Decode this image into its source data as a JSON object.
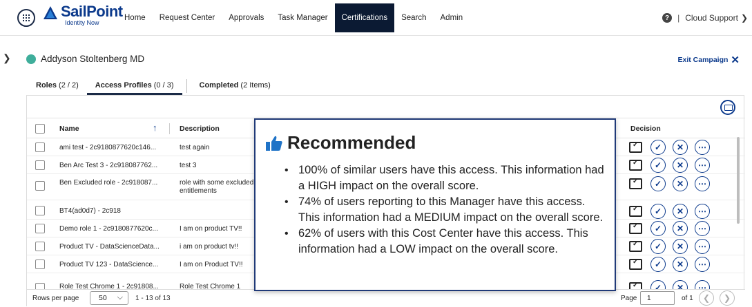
{
  "nav": {
    "brand": "SailPoint",
    "brand_sub": "Identity Now",
    "items": [
      "Home",
      "Request Center",
      "Approvals",
      "Task Manager",
      "Certifications",
      "Search",
      "Admin"
    ],
    "active": "Certifications",
    "user": "Cloud Support",
    "separator": "|"
  },
  "identity": {
    "name": "Addyson Stoltenberg MD",
    "exit_label": "Exit Campaign"
  },
  "tabs": [
    {
      "label": "Roles",
      "count": "(2 / 2)"
    },
    {
      "label": "Access Profiles",
      "count": "(0 / 3)"
    },
    {
      "label": "Completed",
      "count": "(2 Items)"
    }
  ],
  "table": {
    "headers": {
      "name": "Name",
      "description": "Description",
      "decision": "Decision"
    },
    "rows": [
      {
        "name": "ami test - 2c9180877620c146...",
        "description": "test again"
      },
      {
        "name": "Ben Arc Test 3 - 2c918087762...",
        "description": "test 3"
      },
      {
        "name": "Ben Excluded role - 2c918087...",
        "description": "role with some excluded entitlements"
      },
      {
        "name": "BT4(ad0d7) - 2c918",
        "description": ""
      },
      {
        "name": "Demo role 1 - 2c9180877620c...",
        "description": "I am on product TV!!"
      },
      {
        "name": "Product TV - DataScienceData...",
        "description": "i am on product tv!!"
      },
      {
        "name": "Product TV 123 - DataScience...",
        "description": "I am on Product TV!!"
      },
      {
        "name": "Role Test Chrome 1 - 2c91808...",
        "description": "Role Test Chrome 1"
      }
    ]
  },
  "footer": {
    "rows_per_page_label": "Rows per page",
    "rows_per_page_value": "50",
    "range": "1 - 13 of 13",
    "page_label": "Page",
    "page_value": "1",
    "of_label": "of 1"
  },
  "recommendation": {
    "title": "Recommended",
    "points": [
      "100% of similar users have this access. This information had a HIGH impact on the overall score.",
      "74% of users reporting to this Manager have this access. This information had a MEDIUM impact on the overall score.",
      "62% of users with this Cost Center have this access. This information had a LOW impact on the overall score."
    ]
  },
  "colors": {
    "brand": "#0c3a8c",
    "nav_active": "#0b1a33",
    "avatar": "#3fae9b"
  }
}
